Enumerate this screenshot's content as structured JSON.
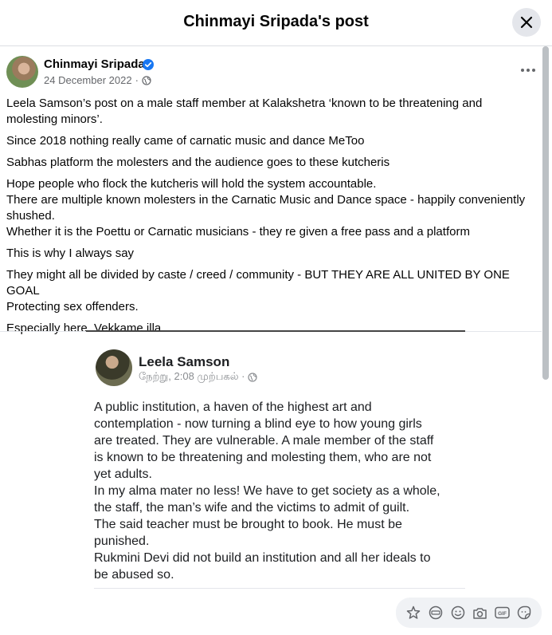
{
  "header": {
    "title": "Chinmayi Sripada's post"
  },
  "post": {
    "author": "Chinmayi Sripada",
    "date": "24 December 2022",
    "paragraphs": [
      "Leela Samson’s post on a male staff member at Kalakshetra ‘known to be threatening and molesting minors’.",
      "Since 2018 nothing really came of carnatic music and dance MeToo",
      "Sabhas platform the molesters and the audience goes to these kutcheris",
      "Hope people who flock the kutcheris will hold the system accountable.",
      "There are multiple known molesters in the Carnatic Music and Dance space - happily conveniently shushed.",
      "Whether it is the Poettu or Carnatic musicians - they re given a free pass and a platform",
      "This is why I always say",
      "They might all be divided by caste / creed / community - BUT THEY ARE ALL UNITED BY ONE GOAL",
      "Protecting sex offenders.",
      "Especially here. Vekkame illa ."
    ]
  },
  "embedded": {
    "author": "Leela Samson",
    "meta": "நேற்று, 2:08 முற்பகல் ·",
    "lines": [
      "A public institution, a haven of the highest art and",
      "contemplation - now turning a blind eye to how young girls",
      "are treated. They are vulnerable. A male member of the staff",
      "is known to be threatening and molesting them, who are not",
      "yet adults.",
      "In my alma mater no less! We have to get society as a whole,",
      "the staff, the man’s wife and the victims to admit of guilt.",
      "The said teacher must be brought to book. He must be",
      "punished.",
      "Rukmini Devi did not build an institution and all her ideals to",
      "be abused so."
    ]
  },
  "icons": {
    "close": "close-icon",
    "verified": "verified-badge-icon",
    "privacy": "globe-icon",
    "more": "more-options-icon",
    "toolbar": [
      "avatar-sticker-icon",
      "gif-avatar-icon",
      "emoji-icon",
      "camera-icon",
      "gif-icon",
      "sticker-icon"
    ]
  },
  "colors": {
    "verified": "#1877f2",
    "secondary_text": "#65676b",
    "toolbar_bg": "#f0f2f5"
  }
}
